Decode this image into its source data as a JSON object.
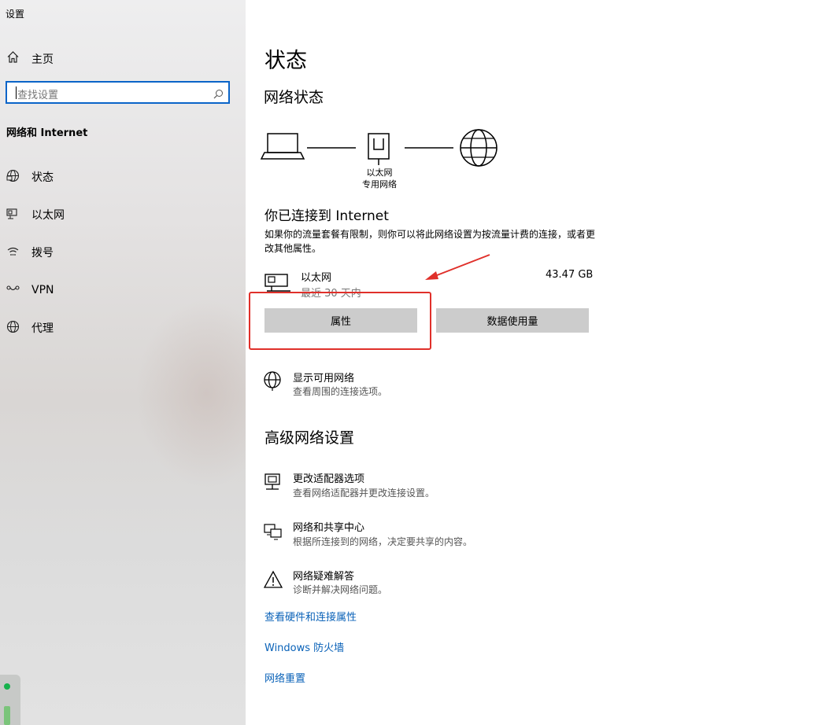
{
  "window": {
    "title": "设置"
  },
  "sidebar": {
    "home_label": "主页",
    "search_placeholder": "查找设置",
    "section_title": "网络和 Internet",
    "items": [
      {
        "label": "状态",
        "icon": "status-globe-icon"
      },
      {
        "label": "以太网",
        "icon": "ethernet-icon"
      },
      {
        "label": "拨号",
        "icon": "dialup-icon"
      },
      {
        "label": "VPN",
        "icon": "vpn-icon"
      },
      {
        "label": "代理",
        "icon": "proxy-globe-icon"
      }
    ]
  },
  "main": {
    "page_title": "状态",
    "network_status_title": "网络状态",
    "diagram": {
      "adapter_label_line1": "以太网",
      "adapter_label_line2": "专用网络"
    },
    "connected_title": "你已连接到 Internet",
    "connected_desc": "如果你的流量套餐有限制，则你可以将此网络设置为按流量计费的连接，或者更改其他属性。",
    "connection": {
      "name": "以太网",
      "period": "最近 30 天内",
      "usage": "43.47 GB"
    },
    "buttons": {
      "properties": "属性",
      "data_usage": "数据使用量"
    },
    "show_networks": {
      "title": "显示可用网络",
      "desc": "查看周围的连接选项。"
    },
    "advanced_title": "高级网络设置",
    "advanced_items": [
      {
        "title": "更改适配器选项",
        "desc": "查看网络适配器并更改连接设置。"
      },
      {
        "title": "网络和共享中心",
        "desc": "根据所连接到的网络，决定要共享的内容。"
      },
      {
        "title": "网络疑难解答",
        "desc": "诊断并解决网络问题。"
      }
    ],
    "links": [
      "查看硬件和连接属性",
      "Windows 防火墙",
      "网络重置"
    ]
  },
  "colors": {
    "accent": "#0a64c8",
    "link": "#0a62b8",
    "annotation": "#e0302a",
    "button_bg": "#cccccc"
  }
}
